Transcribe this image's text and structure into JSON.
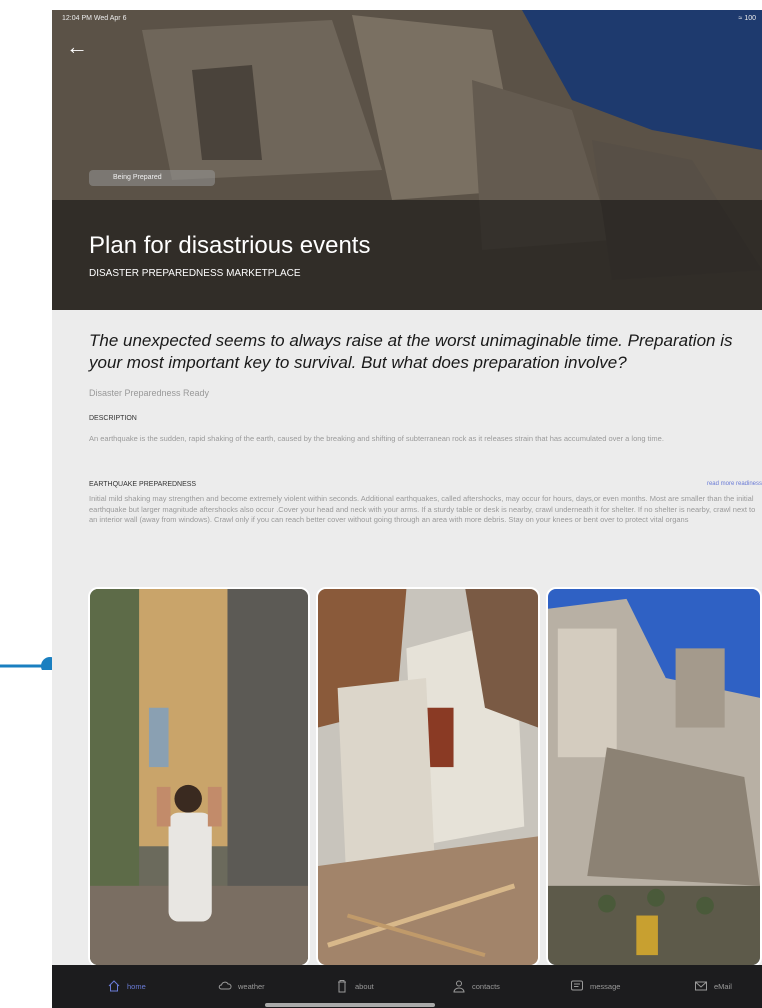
{
  "status_bar": {
    "time": "12:04 PM  Wed Apr 6",
    "battery": "100"
  },
  "hero": {
    "badge": "Being Prepared",
    "title": "Plan for disastrious events",
    "subtitle": "DISASTER PREPAREDNESS MARKETPLACE"
  },
  "content": {
    "tagline": "The unexpected seems to always raise at the worst unimaginable time. Preparation is your most important key to survival. But what does preparation involve?",
    "source": "Disaster Preparedness Ready",
    "description_label": "DESCRIPTION",
    "description_text": "An earthquake is the sudden, rapid shaking of the earth, caused by the breaking and shifting of subterranean rock as it releases strain that has accumulated over a long time.",
    "earthquake_label": "EARTHQUAKE PREPAREDNESS",
    "read_more": "read more readiness",
    "earthquake_text": "Initial mild shaking may strengthen and become extremely violent within seconds. Additional earthquakes, called aftershocks, may occur for hours, days,or even months. Most are smaller than the initial earthquake but larger magnitude aftershocks also occur .Cover your head and neck with your arms. If a sturdy table or desk is nearby, crawl underneath it for shelter. If no shelter is nearby, crawl next to an interior wall (away from windows). Crawl only if you can reach better cover without going through an area with more debris. Stay on your knees or bent over to protect vital organs"
  },
  "tabs": [
    {
      "label": "home",
      "icon": "home-icon",
      "active": true
    },
    {
      "label": "weather",
      "icon": "cloud-icon",
      "active": false
    },
    {
      "label": "about",
      "icon": "trash-icon",
      "active": false
    },
    {
      "label": "contacts",
      "icon": "person-icon",
      "active": false
    },
    {
      "label": "message",
      "icon": "message-icon",
      "active": false
    },
    {
      "label": "eMail",
      "icon": "mail-icon",
      "active": false
    }
  ],
  "colors": {
    "accent": "#6a7bd6",
    "tab_bar": "#1c1c1e",
    "background": "#ececec"
  }
}
